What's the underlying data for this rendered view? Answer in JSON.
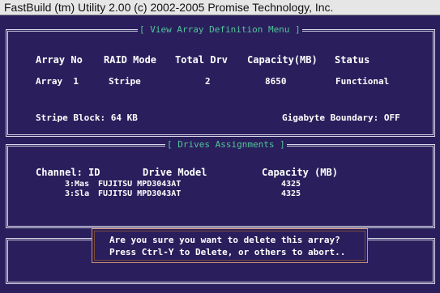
{
  "window": {
    "title": "FastBuild (tm) Utility 2.00 (c) 2002-2005 Promise Technology, Inc."
  },
  "array_panel": {
    "title": "[ View Array Definition Menu ]",
    "headers": {
      "array_no": "Array No",
      "raid_mode": "RAID Mode",
      "total_drv": "Total Drv",
      "capacity": "Capacity(MB)",
      "status": "Status"
    },
    "row": {
      "array_no": "Array  1",
      "raid_mode": "Stripe",
      "total_drv": "2",
      "capacity": "8650",
      "status": "Functional"
    },
    "stripe_block": "Stripe Block: 64 KB",
    "gigabyte_boundary": "Gigabyte Boundary: OFF"
  },
  "drives_panel": {
    "title": "[ Drives Assignments ]",
    "headers": {
      "channel": "Channel: ID",
      "model": "Drive Model",
      "capacity": "Capacity (MB)"
    },
    "drives": [
      {
        "channel": "3:Mas",
        "model": "FUJITSU MPD3043AT",
        "capacity": "4325"
      },
      {
        "channel": "3:Sla",
        "model": "FUJITSU MPD3043AT",
        "capacity": "4325"
      }
    ]
  },
  "dialog": {
    "line1": "Are you sure you want to delete this array?",
    "line2": "Press Ctrl-Y to Delete, or others to abort.."
  }
}
